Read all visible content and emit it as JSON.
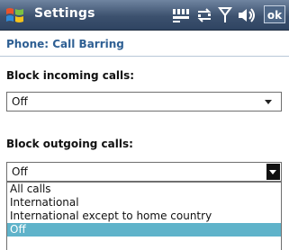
{
  "titlebar": {
    "app_title": "Settings",
    "ok_label": "ok",
    "start_icon": "windows-flag-icon",
    "status_icons": [
      "keyboard-icon",
      "connectivity-icon",
      "signal-icon",
      "volume-icon"
    ]
  },
  "page": {
    "title": "Phone: Call Barring"
  },
  "incoming": {
    "label": "Block incoming calls:",
    "value": "Off"
  },
  "outgoing": {
    "label": "Block outgoing calls:",
    "value": "Off",
    "options": [
      "All calls",
      "International",
      "International except to home country",
      "Off"
    ],
    "selected_index": 3
  },
  "colors": {
    "titlebar": "#3c516e",
    "accent_text": "#2e5f93",
    "selection": "#5fb3ca"
  }
}
